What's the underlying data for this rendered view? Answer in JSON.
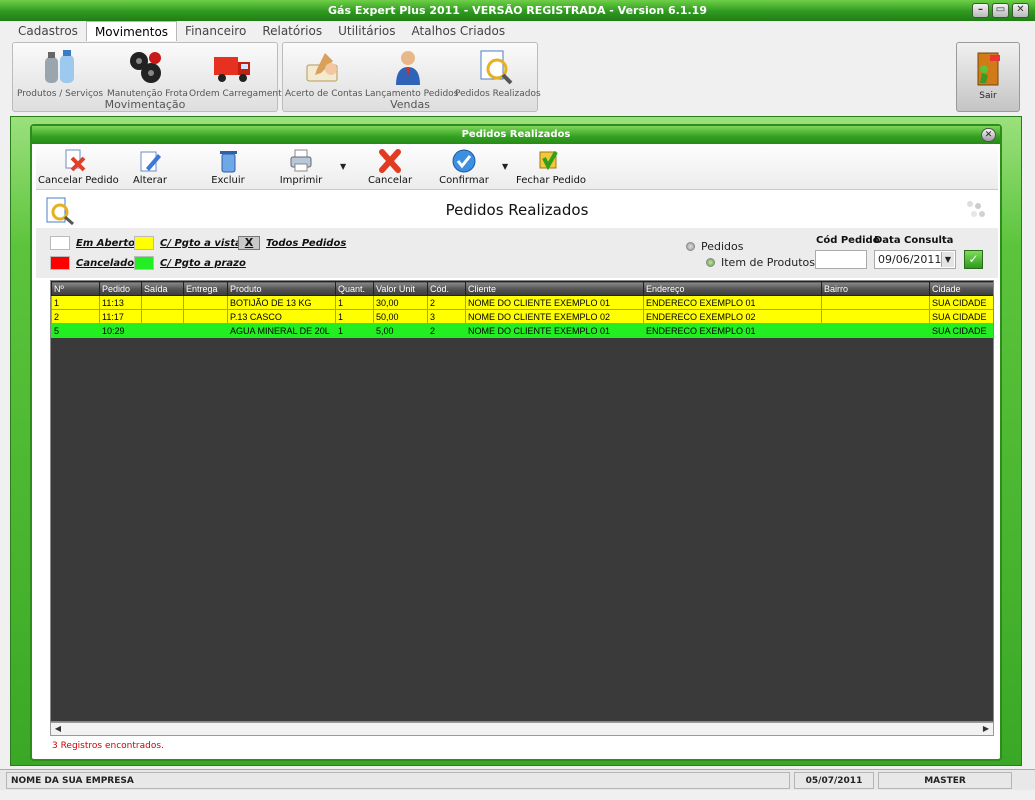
{
  "app": {
    "title": "Gás Expert Plus 2011 - VERSÃO REGISTRADA - Version 6.1.19"
  },
  "ribbon": {
    "tabs": [
      "Cadastros",
      "Movimentos",
      "Financeiro",
      "Relatórios",
      "Utilitários",
      "Atalhos Criados"
    ],
    "active_tab": "Movimentos",
    "groups": [
      {
        "label": "Movimentação",
        "buttons": [
          "Produtos / Serviços",
          "Manutenção Frota",
          "Ordem Carregamento"
        ]
      },
      {
        "label": "Vendas",
        "buttons": [
          "Acerto de Contas",
          "Lançamento Pedidos",
          "Pedidos Realizados"
        ]
      }
    ],
    "exit_label": "Sair"
  },
  "window": {
    "title": "Pedidos Realizados",
    "heading": "Pedidos Realizados",
    "toolbar": {
      "cancel_order": "Cancelar Pedido",
      "edit": "Alterar",
      "delete": "Excluir",
      "print": "Imprimir",
      "cancel": "Cancelar",
      "confirm": "Confirmar",
      "close_order": "Fechar Pedido"
    }
  },
  "legend": {
    "open": "Em Aberto",
    "cash": "C/ Pgto a vista",
    "all_marker": "X",
    "all": "Todos Pedidos",
    "cancelled": "Cancelado",
    "term": "C/ Pgto a prazo",
    "colors": {
      "open": "#ffffff",
      "cash": "#ffff00",
      "cancelled": "#ff0000",
      "term": "#22ee22"
    }
  },
  "filters": {
    "radio_orders": "Pedidos",
    "radio_items": "Item de Produtos",
    "order_code_label": "Cód Pedido",
    "order_code_value": "",
    "date_label": "Data Consulta",
    "date_value": "09/06/2011"
  },
  "table": {
    "columns": [
      "Nº",
      "Pedido",
      "Saída",
      "Entrega",
      "Produto",
      "Quant.",
      "Valor Unit",
      "Cód.",
      "Cliente",
      "Endereço",
      "Bairro",
      "Cidade"
    ],
    "rows": [
      {
        "color": "yellow",
        "cells": [
          "1",
          "11:13",
          "",
          "",
          "BOTIJÃO DE 13 KG",
          "1",
          "30,00",
          "2",
          "NOME DO CLIENTE EXEMPLO 01",
          "ENDERECO EXEMPLO 01",
          "",
          "SUA CIDADE"
        ]
      },
      {
        "color": "yellow",
        "cells": [
          "2",
          "11:17",
          "",
          "",
          "P.13 CASCO",
          "1",
          "50,00",
          "3",
          "NOME DO CLIENTE EXEMPLO 02",
          "ENDERECO EXEMPLO 02",
          "",
          "SUA CIDADE"
        ]
      },
      {
        "color": "green",
        "cells": [
          "5",
          "10:29",
          "",
          "",
          "AGUA MINERAL DE 20L",
          "1",
          "5,00",
          "2",
          "NOME DO CLIENTE EXEMPLO 01",
          "ENDERECO EXEMPLO 01",
          "",
          "SUA CIDADE"
        ]
      }
    ],
    "count_text": "3 Registros encontrados."
  },
  "status": {
    "company": "NOME DA SUA EMPRESA",
    "date": "05/07/2011",
    "user": "MASTER"
  }
}
